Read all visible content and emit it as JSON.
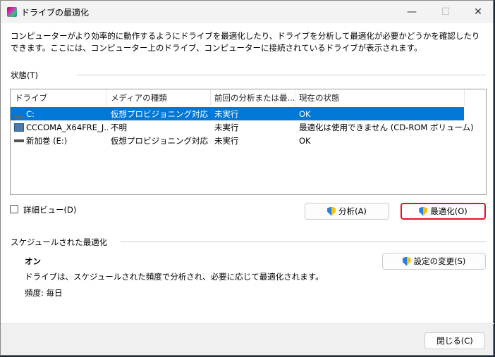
{
  "window": {
    "title": "ドライブの最適化",
    "minimize": "—",
    "maximize": "☐",
    "close": "✕"
  },
  "description": "コンピューターがより効率的に動作するようにドライブを最適化したり、ドライブを分析して最適化が必要かどうかを確認したりできます。ここには、コンピューター上のドライブ、コンピューターに接続されているドライブが表示されます。",
  "status_label": "状態(T)",
  "columns": [
    "ドライブ",
    "メディアの種類",
    "前回の分析または最...",
    "現在の状態"
  ],
  "drives": [
    {
      "name": "C:",
      "media": "仮想プロビジョニング対応ド...",
      "last": "未実行",
      "status": "OK"
    },
    {
      "name": "CCCOMA_X64FRE_J...",
      "media": "不明",
      "last": "未実行",
      "status": "最適化は使用できません (CD-ROM ボリューム)"
    },
    {
      "name": "新加巻 (E:)",
      "media": "仮想プロビジョニング対応ド...",
      "last": "未実行",
      "status": "OK"
    }
  ],
  "detail_view": "詳細ビュー(D)",
  "analyze": "分析(A)",
  "optimize": "最適化(O)",
  "scheduled": {
    "heading": "スケジュールされた最適化",
    "state": "オン",
    "desc": "ドライブは、スケジュールされた頻度で分析され、必要に応じて最適化されます。",
    "freq": "頻度: 毎日",
    "change": "設定の変更(S)"
  },
  "close_button": "閉じる(C)",
  "colors": {
    "selection": "#0078d7",
    "highlight": "#e81123"
  }
}
